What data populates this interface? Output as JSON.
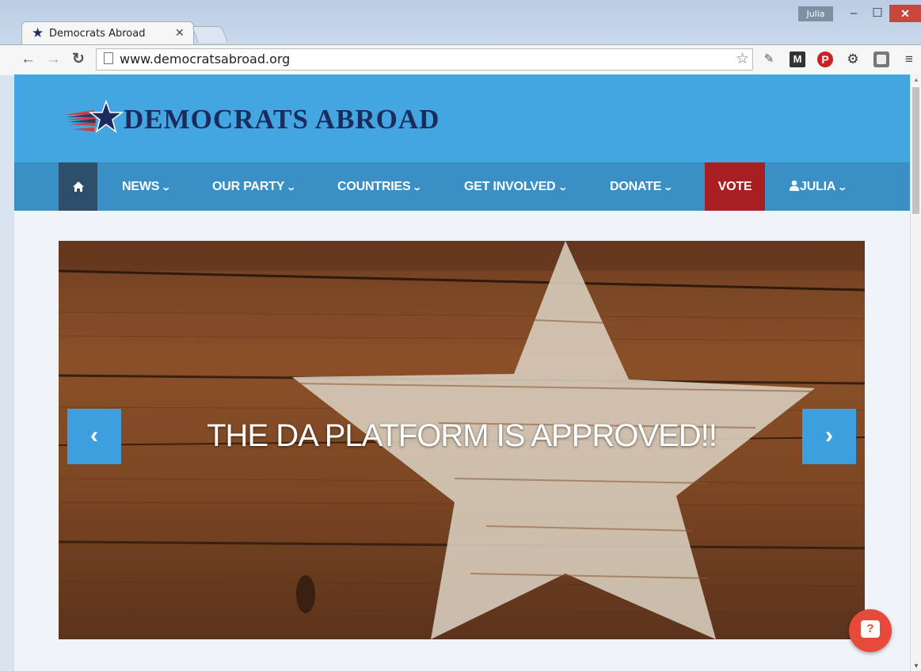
{
  "browser": {
    "tab_title": "Democrats Abroad",
    "url": "www.democratsabroad.org",
    "profile_name": "Julia"
  },
  "site": {
    "logo_text": "DEMOCRATS ABROAD",
    "colors": {
      "header": "#43a6e0",
      "nav": "#3a8fc5",
      "vote": "#a81e22",
      "logo": "#1b2b5d"
    }
  },
  "nav": {
    "items": [
      {
        "label": "NEWS"
      },
      {
        "label": "OUR PARTY"
      },
      {
        "label": "COUNTRIES"
      },
      {
        "label": "GET INVOLVED"
      },
      {
        "label": "DONATE"
      },
      {
        "label": "VOTE"
      },
      {
        "label": "JULIA"
      }
    ]
  },
  "carousel": {
    "caption": "THE DA PLATFORM IS APPROVED!!"
  },
  "icons": {
    "tab_favicon": "star-icon",
    "help": "question-bubble-icon",
    "home": "home-icon",
    "user": "user-icon"
  }
}
